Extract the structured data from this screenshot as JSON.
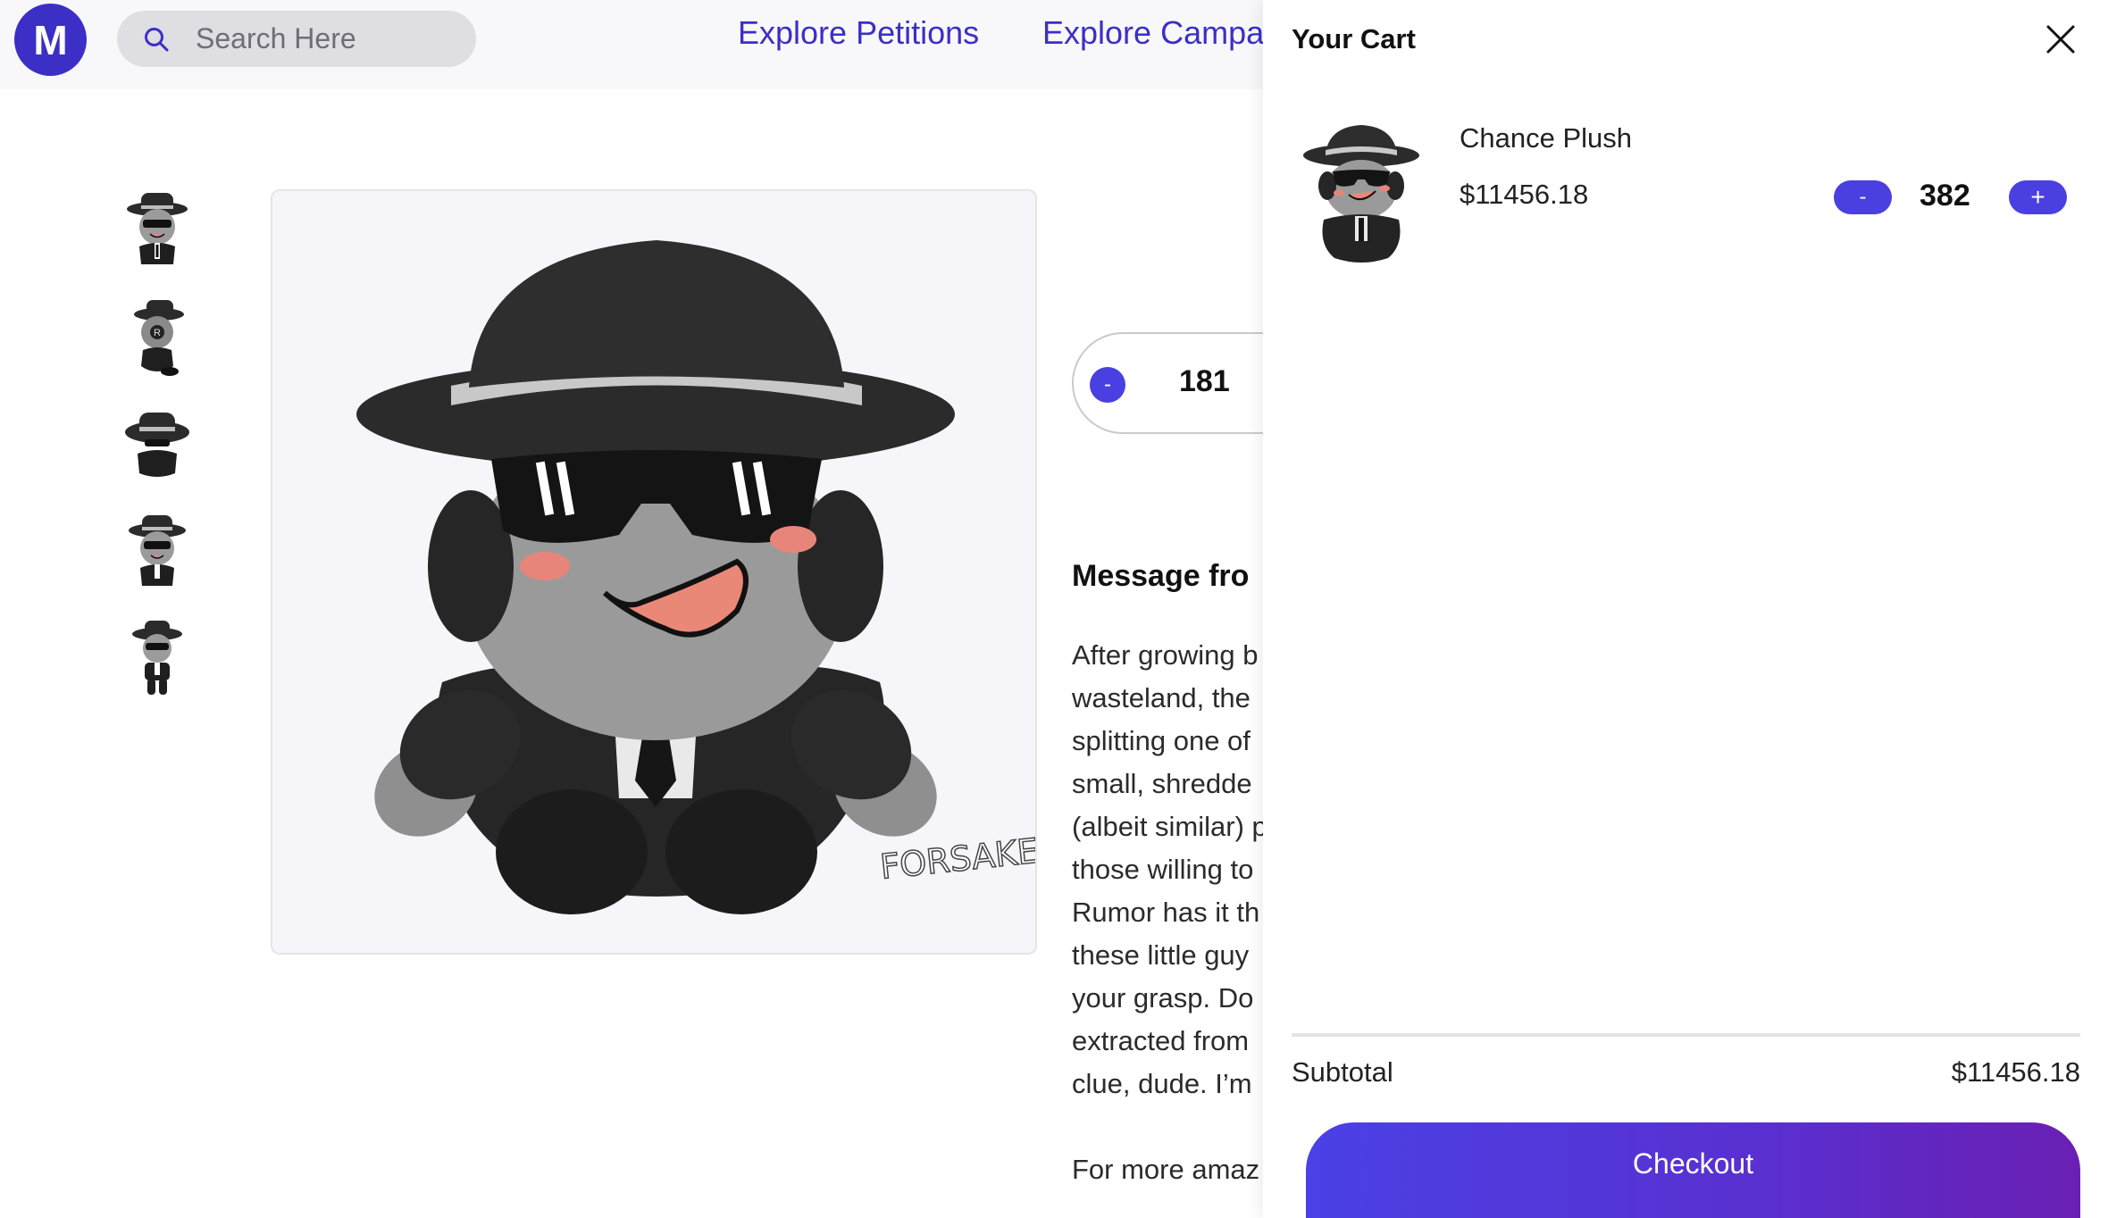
{
  "header": {
    "logo_letter": "M",
    "search_placeholder": "Search Here",
    "nav": [
      "Explore Petitions",
      "Explore Campa"
    ]
  },
  "icons": {
    "search": "search-icon",
    "close": "close-icon"
  },
  "product": {
    "image_watermark": "FORSAKEN",
    "quantity": "181",
    "minus_label": "-",
    "message_title": "Message fro",
    "description_lines": [
      "After growing b",
      "wasteland, the",
      "splitting one of",
      "small, shredde",
      "(albeit similar) p",
      "those willing to",
      "Rumor has it th",
      "these little guy",
      "your grasp. Do",
      "extracted from",
      "clue, dude. I’m"
    ],
    "more_line": "For more amaz"
  },
  "cart": {
    "title": "Your Cart",
    "item": {
      "name": "Chance Plush",
      "price": "$11456.18",
      "quantity": "382",
      "minus_label": "-",
      "plus_label": "+"
    },
    "subtotal_label": "Subtotal",
    "subtotal_value": "$11456.18",
    "checkout_label": "Checkout"
  },
  "colors": {
    "brand": "#3b2fc6",
    "button": "#4a3fe0",
    "checkout_gradient_end": "#6a1fb3"
  }
}
